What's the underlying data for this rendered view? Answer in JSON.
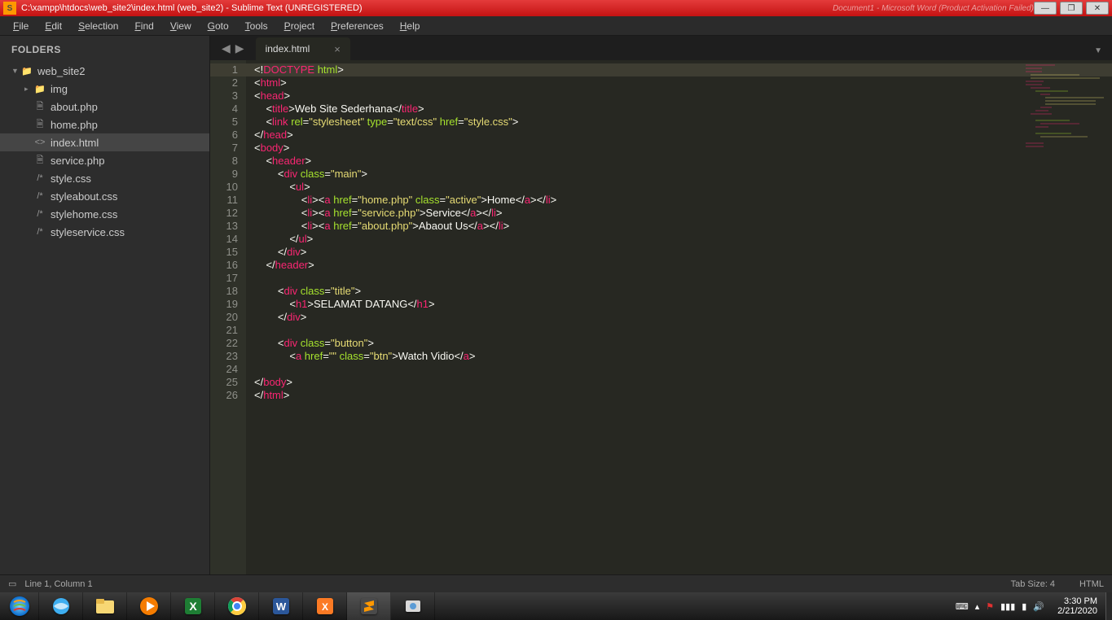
{
  "titlebar": {
    "title": "C:\\xampp\\htdocs\\web_site2\\index.html (web_site2) - Sublime Text (UNREGISTERED)",
    "ghost": "Document1 - Microsoft Word (Product Activation Failed)"
  },
  "menu": [
    "File",
    "Edit",
    "Selection",
    "Find",
    "View",
    "Goto",
    "Tools",
    "Project",
    "Preferences",
    "Help"
  ],
  "sidebar": {
    "header": "FOLDERS",
    "root": "web_site2",
    "folder": "img",
    "files": [
      "about.php",
      "home.php",
      "index.html",
      "service.php",
      "style.css",
      "styleabout.css",
      "stylehome.css",
      "styleservice.css"
    ],
    "selected": "index.html"
  },
  "tab": {
    "name": "index.html"
  },
  "code": {
    "lines": [
      [
        [
          "p",
          "<!"
        ],
        [
          "doc",
          "DOCTYPE"
        ],
        [
          "p",
          " "
        ],
        [
          "a",
          "html"
        ],
        [
          "p",
          ">"
        ]
      ],
      [
        [
          "p",
          "<"
        ],
        [
          "t",
          "html"
        ],
        [
          "p",
          ">"
        ]
      ],
      [
        [
          "p",
          "<"
        ],
        [
          "t",
          "head"
        ],
        [
          "p",
          ">"
        ]
      ],
      [
        [
          "p",
          "    <"
        ],
        [
          "t",
          "title"
        ],
        [
          "p",
          ">Web Site Sederhana</"
        ],
        [
          "t",
          "title"
        ],
        [
          "p",
          ">"
        ]
      ],
      [
        [
          "p",
          "    <"
        ],
        [
          "t",
          "link"
        ],
        [
          "p",
          " "
        ],
        [
          "a",
          "rel"
        ],
        [
          "p",
          "="
        ],
        [
          "s",
          "\"stylesheet\""
        ],
        [
          "p",
          " "
        ],
        [
          "a",
          "type"
        ],
        [
          "p",
          "="
        ],
        [
          "s",
          "\"text/css\""
        ],
        [
          "p",
          " "
        ],
        [
          "a",
          "href"
        ],
        [
          "p",
          "="
        ],
        [
          "s",
          "\"style.css\""
        ],
        [
          "p",
          ">"
        ]
      ],
      [
        [
          "p",
          "</"
        ],
        [
          "t",
          "head"
        ],
        [
          "p",
          ">"
        ]
      ],
      [
        [
          "p",
          "<"
        ],
        [
          "t",
          "body"
        ],
        [
          "p",
          ">"
        ]
      ],
      [
        [
          "p",
          "    <"
        ],
        [
          "t",
          "header"
        ],
        [
          "p",
          ">"
        ]
      ],
      [
        [
          "p",
          "        <"
        ],
        [
          "t",
          "div"
        ],
        [
          "p",
          " "
        ],
        [
          "a",
          "class"
        ],
        [
          "p",
          "="
        ],
        [
          "s",
          "\"main\""
        ],
        [
          "p",
          ">"
        ]
      ],
      [
        [
          "p",
          "            <"
        ],
        [
          "t",
          "ul"
        ],
        [
          "p",
          ">"
        ]
      ],
      [
        [
          "p",
          "                <"
        ],
        [
          "t",
          "li"
        ],
        [
          "p",
          "><"
        ],
        [
          "t",
          "a"
        ],
        [
          "p",
          " "
        ],
        [
          "a",
          "href"
        ],
        [
          "p",
          "="
        ],
        [
          "s",
          "\"home.php\""
        ],
        [
          "p",
          " "
        ],
        [
          "a",
          "class"
        ],
        [
          "p",
          "="
        ],
        [
          "s",
          "\"active\""
        ],
        [
          "p",
          ">Home</"
        ],
        [
          "t",
          "a"
        ],
        [
          "p",
          "></"
        ],
        [
          "t",
          "li"
        ],
        [
          "p",
          ">"
        ]
      ],
      [
        [
          "p",
          "                <"
        ],
        [
          "t",
          "li"
        ],
        [
          "p",
          "><"
        ],
        [
          "t",
          "a"
        ],
        [
          "p",
          " "
        ],
        [
          "a",
          "href"
        ],
        [
          "p",
          "="
        ],
        [
          "s",
          "\"service.php\""
        ],
        [
          "p",
          ">Service</"
        ],
        [
          "t",
          "a"
        ],
        [
          "p",
          "></"
        ],
        [
          "t",
          "li"
        ],
        [
          "p",
          ">"
        ]
      ],
      [
        [
          "p",
          "                <"
        ],
        [
          "t",
          "li"
        ],
        [
          "p",
          "><"
        ],
        [
          "t",
          "a"
        ],
        [
          "p",
          " "
        ],
        [
          "a",
          "href"
        ],
        [
          "p",
          "="
        ],
        [
          "s",
          "\"about.php\""
        ],
        [
          "p",
          ">Abaout Us</"
        ],
        [
          "t",
          "a"
        ],
        [
          "p",
          "></"
        ],
        [
          "t",
          "li"
        ],
        [
          "p",
          ">"
        ]
      ],
      [
        [
          "p",
          "            </"
        ],
        [
          "t",
          "ul"
        ],
        [
          "p",
          ">"
        ]
      ],
      [
        [
          "p",
          "        </"
        ],
        [
          "t",
          "div"
        ],
        [
          "p",
          ">"
        ]
      ],
      [
        [
          "p",
          "    </"
        ],
        [
          "t",
          "header"
        ],
        [
          "p",
          ">"
        ]
      ],
      [
        [
          "p",
          ""
        ]
      ],
      [
        [
          "p",
          "        <"
        ],
        [
          "t",
          "div"
        ],
        [
          "p",
          " "
        ],
        [
          "a",
          "class"
        ],
        [
          "p",
          "="
        ],
        [
          "s",
          "\"title\""
        ],
        [
          "p",
          ">"
        ]
      ],
      [
        [
          "p",
          "            <"
        ],
        [
          "t",
          "h1"
        ],
        [
          "p",
          ">SELAMAT DATANG</"
        ],
        [
          "t",
          "h1"
        ],
        [
          "p",
          ">"
        ]
      ],
      [
        [
          "p",
          "        </"
        ],
        [
          "t",
          "div"
        ],
        [
          "p",
          ">"
        ]
      ],
      [
        [
          "p",
          ""
        ]
      ],
      [
        [
          "p",
          "        <"
        ],
        [
          "t",
          "div"
        ],
        [
          "p",
          " "
        ],
        [
          "a",
          "class"
        ],
        [
          "p",
          "="
        ],
        [
          "s",
          "\"button\""
        ],
        [
          "p",
          ">"
        ]
      ],
      [
        [
          "p",
          "            <"
        ],
        [
          "t",
          "a"
        ],
        [
          "p",
          " "
        ],
        [
          "a",
          "href"
        ],
        [
          "p",
          "="
        ],
        [
          "s",
          "\"\""
        ],
        [
          "p",
          " "
        ],
        [
          "a",
          "class"
        ],
        [
          "p",
          "="
        ],
        [
          "s",
          "\"btn\""
        ],
        [
          "p",
          ">Watch Vidio</"
        ],
        [
          "t",
          "a"
        ],
        [
          "p",
          ">"
        ]
      ],
      [
        [
          "p",
          ""
        ]
      ],
      [
        [
          "p",
          "</"
        ],
        [
          "t",
          "body"
        ],
        [
          "p",
          ">"
        ]
      ],
      [
        [
          "p",
          "</"
        ],
        [
          "t",
          "html"
        ],
        [
          "p",
          ">"
        ]
      ]
    ]
  },
  "status": {
    "cursor": "Line 1, Column 1",
    "tabsize": "Tab Size: 4",
    "syntax": "HTML"
  },
  "taskbar": {
    "time": "3:30 PM",
    "date": "2/21/2020"
  }
}
